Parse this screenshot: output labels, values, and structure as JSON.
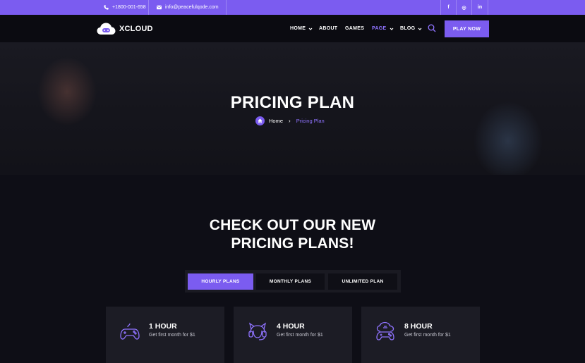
{
  "topbar": {
    "phone": "+1800-001-658",
    "email": "info@peacefulqode.com",
    "social": [
      "f",
      "◎",
      "in"
    ]
  },
  "brand": {
    "name": "XCLOUD"
  },
  "nav": {
    "items": [
      {
        "label": "HOME",
        "dropdown": true
      },
      {
        "label": "ABOUT",
        "dropdown": false
      },
      {
        "label": "GAMES",
        "dropdown": false
      },
      {
        "label": "PAGE",
        "dropdown": true,
        "active": true
      },
      {
        "label": "BLOG",
        "dropdown": true
      }
    ],
    "cta": "PLAY NOW"
  },
  "hero": {
    "title": "PRICING PLAN",
    "breadcrumb": {
      "home": "Home",
      "current": "Pricing Plan"
    }
  },
  "pricing": {
    "title_line1": "CHECK OUT OUR NEW",
    "title_line2": "PRICING PLANS!",
    "tabs": [
      "HOURLY PLANS",
      "MONTHLY PLANS",
      "UNLIMITED PLAN"
    ],
    "active_tab": 0,
    "cards": [
      {
        "title": "1 HOUR",
        "subtitle": "Get first month for $1",
        "icon": "gamepad-icon"
      },
      {
        "title": "4 HOUR",
        "subtitle": "Get first month for $1",
        "icon": "headset-icon"
      },
      {
        "title": "8 HOUR",
        "subtitle": "Get first month for $1",
        "icon": "cloud-gamepad-icon"
      }
    ]
  },
  "colors": {
    "accent": "#7b5cf0",
    "background": "#0e0e16",
    "card": "#1c1c25"
  }
}
